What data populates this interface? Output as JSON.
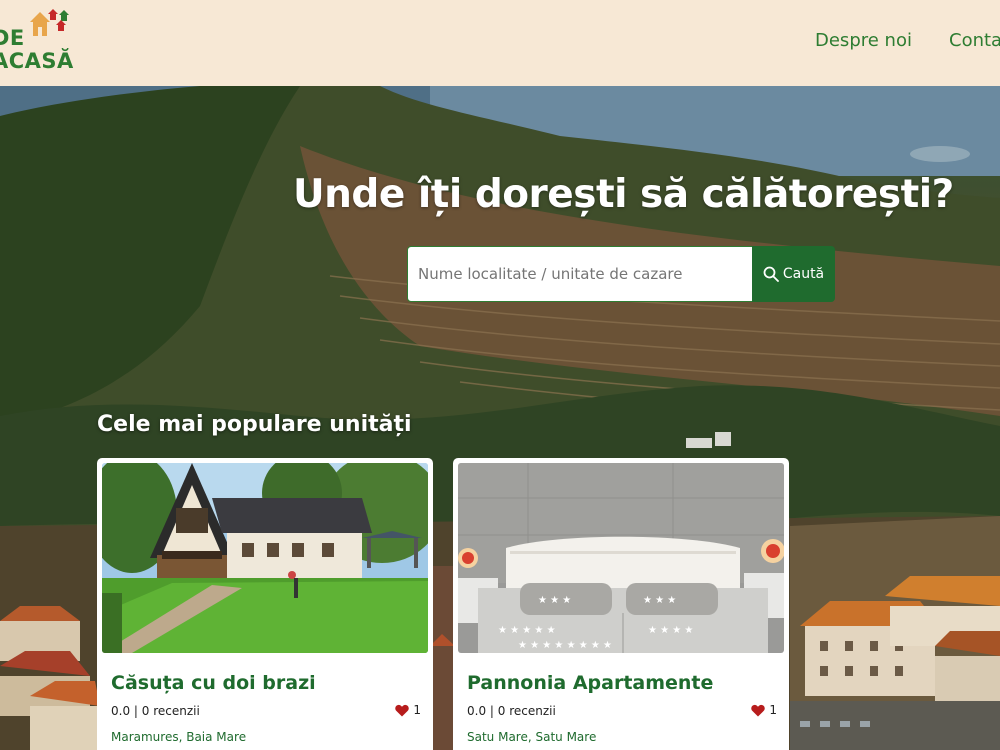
{
  "header": {
    "logo_line1": "DE",
    "logo_line2": "ACASĂ",
    "nav": {
      "about": "Despre noi",
      "contact": "Contact"
    }
  },
  "hero": {
    "title": "Unde îți dorești să călătorești?",
    "search": {
      "placeholder": "Nume localitate / unitate de cazare",
      "button_label": "Caută",
      "button_icon": "search-icon"
    }
  },
  "popular": {
    "title": "Cele mai populare unități",
    "cards": [
      {
        "name": "Căsuța cu doi brazi",
        "rating_text": "0.0 | 0 recenzii",
        "likes": "1",
        "location": "Maramures, Baia Mare"
      },
      {
        "name": "Pannonia Apartamente",
        "rating_text": "0.0 | 0 recenzii",
        "likes": "1",
        "location": "Satu Mare, Satu Mare"
      }
    ]
  },
  "colors": {
    "brand_green": "#2e7d32",
    "button_green": "#1f6b2e",
    "header_bg": "#f7e8d5",
    "heart_red": "#b71c1c"
  }
}
